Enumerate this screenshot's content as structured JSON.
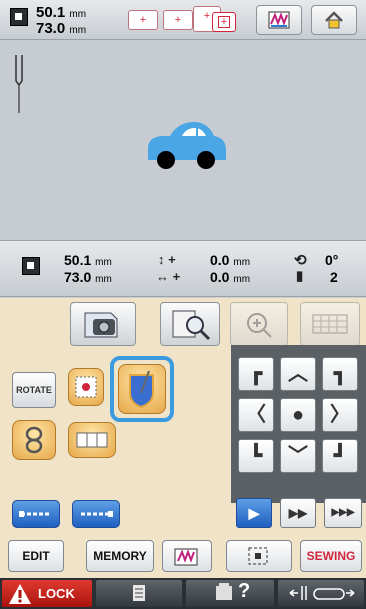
{
  "top": {
    "width": "50.1",
    "height": "73.0",
    "unit": "mm",
    "hoop_buttons": [
      "+",
      "+",
      "+"
    ],
    "hoop_active": "+"
  },
  "info": {
    "width": "50.1",
    "height": "73.0",
    "unit": "mm",
    "offset_y_sign": "+",
    "offset_y": "0.0",
    "offset_x_sign": "+",
    "offset_x": "0.0",
    "angle": "0°",
    "thread_count": "2"
  },
  "panel": {
    "rotate_label": "ROTATE",
    "edit_label": "EDIT",
    "memory_label": "MEMORY",
    "sewing_label": "SEWING"
  },
  "bottom": {
    "lock_label": "LOCK",
    "help_label": "?"
  },
  "colors": {
    "accent_blue": "#3a9be0",
    "car_blue": "#4aa6e4",
    "sewing_red": "#d0263c",
    "panel_bg": "#f1e3c7"
  }
}
